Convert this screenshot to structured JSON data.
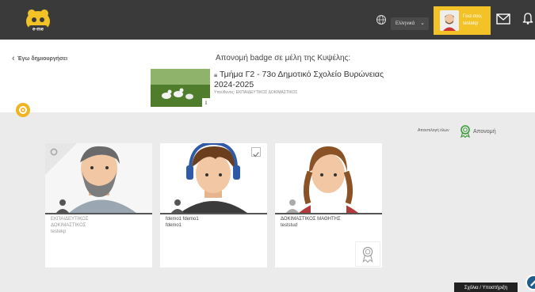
{
  "topbar": {
    "logo_text": "e-me",
    "language": "Ελληνικά",
    "user_greeting": "Γεια σου,",
    "username": "testekp"
  },
  "header": {
    "back_label": "Έγω δημιουργήσει",
    "title": "Απονομή badge σε μέλη της Κυψέλης:",
    "class_name": "Τμήμα Γ2 - 73ο Δημοτικό Σχολείο Βυρώνειας 2024-2025",
    "responsible": "Υπεύθυνος: ΕΚΠΑΙΔΕΥΤΙΚΟΣ ΔΟΚΙΜΑΣΤΙΚΟΣ",
    "info_label": "i"
  },
  "actions": {
    "select_all": "Αποεπιλογή όλων",
    "award": "Απονομή"
  },
  "cards": [
    {
      "name_line1": "ΕΚΠΑΙΔΕΥΤΙΚΟΣ",
      "name_line2": "ΔΟΚΙΜΑΣΤΙΚΟΣ",
      "username": "testekp"
    },
    {
      "name_line1": "fdemo1 fdemo1",
      "username": "fdemo1"
    },
    {
      "name_line1": "ΔΟΚΙΜΑΣΤΙΚΟΣ ΜΑΘΗΤΗΣ",
      "username": "teststud"
    }
  ],
  "footer": {
    "help": "Σχόλια / Υποστήριξη"
  },
  "colors": {
    "topbar": "#3a3a3a",
    "accent": "#f2c227",
    "award_green": "#3c9a3c"
  }
}
